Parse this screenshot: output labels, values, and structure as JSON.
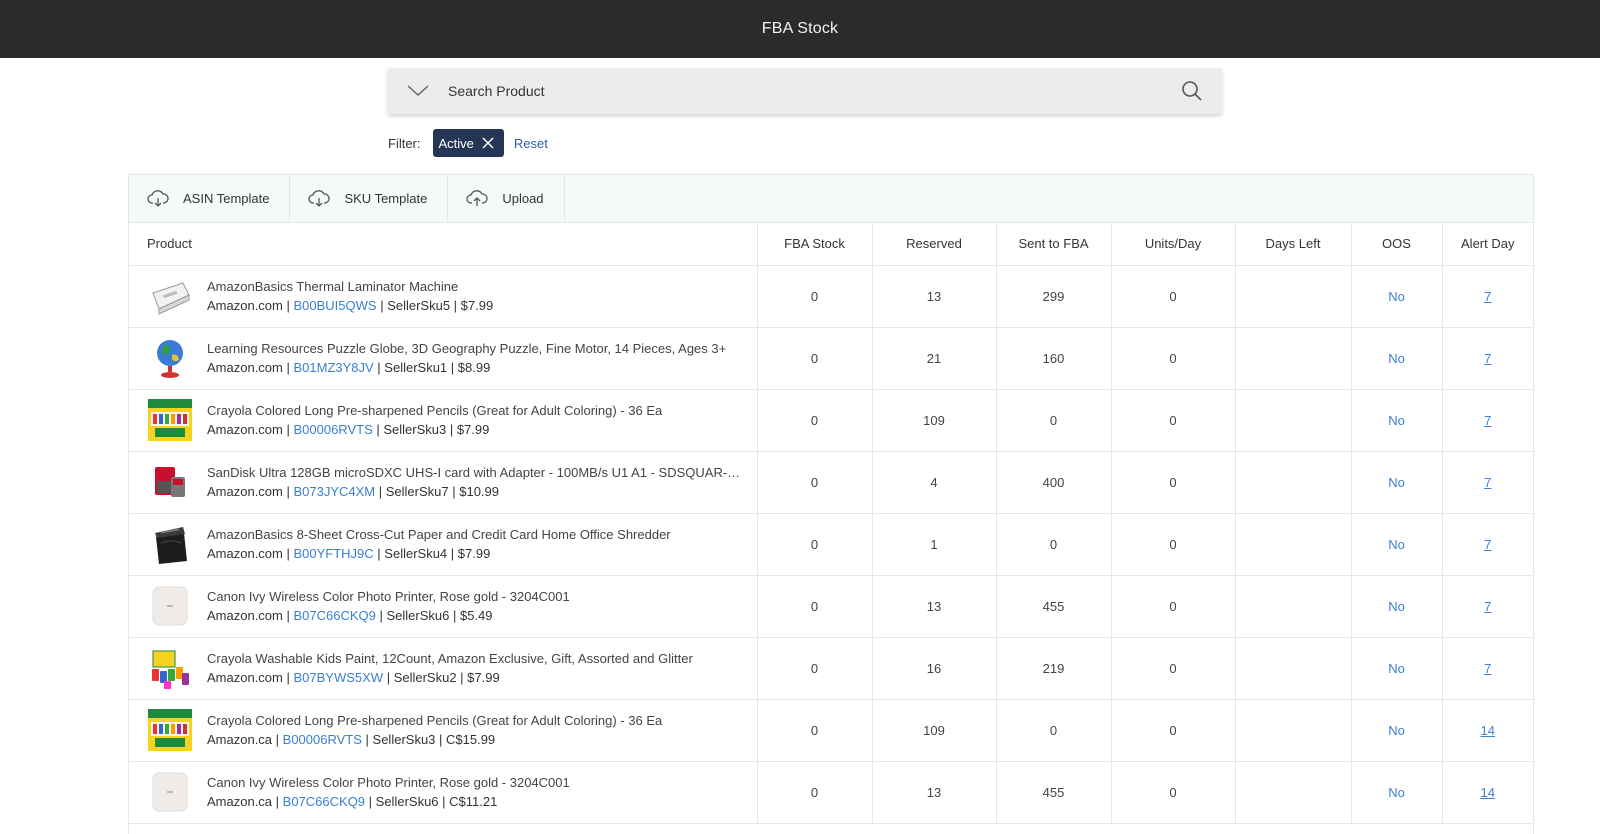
{
  "header": {
    "title": "FBA Stock"
  },
  "search": {
    "placeholder": "Search Product"
  },
  "filter": {
    "label": "Filter:",
    "chip": "Active",
    "reset": "Reset"
  },
  "toolbar": {
    "asin_template": "ASIN Template",
    "sku_template": "SKU Template",
    "upload": "Upload"
  },
  "columns": [
    "Product",
    "FBA Stock",
    "Reserved",
    "Sent to FBA",
    "Units/Day",
    "Days Left",
    "OOS",
    "Alert Day"
  ],
  "rows": [
    {
      "name": "AmazonBasics Thermal Laminator Machine",
      "market": "Amazon.com",
      "asin": "B00BUI5QWS",
      "sku": "SellerSku5",
      "price": "$7.99",
      "fba_stock": "0",
      "reserved": "13",
      "sent": "299",
      "units_day": "0",
      "days_left": "",
      "oos": "No",
      "alert": "7",
      "thumb_icon": "laminator-icon"
    },
    {
      "name": "Learning Resources Puzzle Globe, 3D Geography Puzzle, Fine Motor, 14 Pieces, Ages 3+",
      "market": "Amazon.com",
      "asin": "B01MZ3Y8JV",
      "sku": "SellerSku1",
      "price": "$8.99",
      "fba_stock": "0",
      "reserved": "21",
      "sent": "160",
      "units_day": "0",
      "days_left": "",
      "oos": "No",
      "alert": "7",
      "thumb_icon": "globe-icon"
    },
    {
      "name": "Crayola Colored Long Pre-sharpened Pencils (Great for Adult Coloring) - 36 Ea",
      "market": "Amazon.com",
      "asin": "B00006RVTS",
      "sku": "SellerSku3",
      "price": "$7.99",
      "fba_stock": "0",
      "reserved": "109",
      "sent": "0",
      "units_day": "0",
      "days_left": "",
      "oos": "No",
      "alert": "7",
      "thumb_icon": "pencils-icon"
    },
    {
      "name": "SanDisk Ultra 128GB microSDXC UHS-I card with Adapter - 100MB/s U1 A1 - SDSQUAR-128...",
      "market": "Amazon.com",
      "asin": "B073JYC4XM",
      "sku": "SellerSku7",
      "price": "$10.99",
      "fba_stock": "0",
      "reserved": "4",
      "sent": "400",
      "units_day": "0",
      "days_left": "",
      "oos": "No",
      "alert": "7",
      "thumb_icon": "sdcard-icon"
    },
    {
      "name": "AmazonBasics 8-Sheet Cross-Cut Paper and Credit Card Home Office Shredder",
      "market": "Amazon.com",
      "asin": "B00YFTHJ9C",
      "sku": "SellerSku4",
      "price": "$7.99",
      "fba_stock": "0",
      "reserved": "1",
      "sent": "0",
      "units_day": "0",
      "days_left": "",
      "oos": "No",
      "alert": "7",
      "thumb_icon": "shredder-icon"
    },
    {
      "name": "Canon Ivy Wireless Color Photo Printer, Rose gold - 3204C001",
      "market": "Amazon.com",
      "asin": "B07C66CKQ9",
      "sku": "SellerSku6",
      "price": "$5.49",
      "fba_stock": "0",
      "reserved": "13",
      "sent": "455",
      "units_day": "0",
      "days_left": "",
      "oos": "No",
      "alert": "7",
      "thumb_icon": "printer-icon"
    },
    {
      "name": "Crayola Washable Kids Paint, 12Count, Amazon Exclusive, Gift, Assorted and Glitter",
      "market": "Amazon.com",
      "asin": "B07BYWS5XW",
      "sku": "SellerSku2",
      "price": "$7.99",
      "fba_stock": "0",
      "reserved": "16",
      "sent": "219",
      "units_day": "0",
      "days_left": "",
      "oos": "No",
      "alert": "7",
      "thumb_icon": "paint-icon"
    },
    {
      "name": "Crayola Colored Long Pre-sharpened Pencils (Great for Adult Coloring) - 36 Ea",
      "market": "Amazon.ca",
      "asin": "B00006RVTS",
      "sku": "SellerSku3",
      "price": "C$15.99",
      "fba_stock": "0",
      "reserved": "109",
      "sent": "0",
      "units_day": "0",
      "days_left": "",
      "oos": "No",
      "alert": "14",
      "thumb_icon": "pencils-icon"
    },
    {
      "name": "Canon Ivy Wireless Color Photo Printer, Rose gold - 3204C001",
      "market": "Amazon.ca",
      "asin": "B07C66CKQ9",
      "sku": "SellerSku6",
      "price": "C$11.21",
      "fba_stock": "0",
      "reserved": "13",
      "sent": "455",
      "units_day": "0",
      "days_left": "",
      "oos": "No",
      "alert": "14",
      "thumb_icon": "printer-icon"
    }
  ],
  "colors": {
    "header_bg": "#2b2b2b",
    "chip_bg": "#253555",
    "link": "#3b7fd0",
    "toolbar_bg": "#f5faf6"
  }
}
